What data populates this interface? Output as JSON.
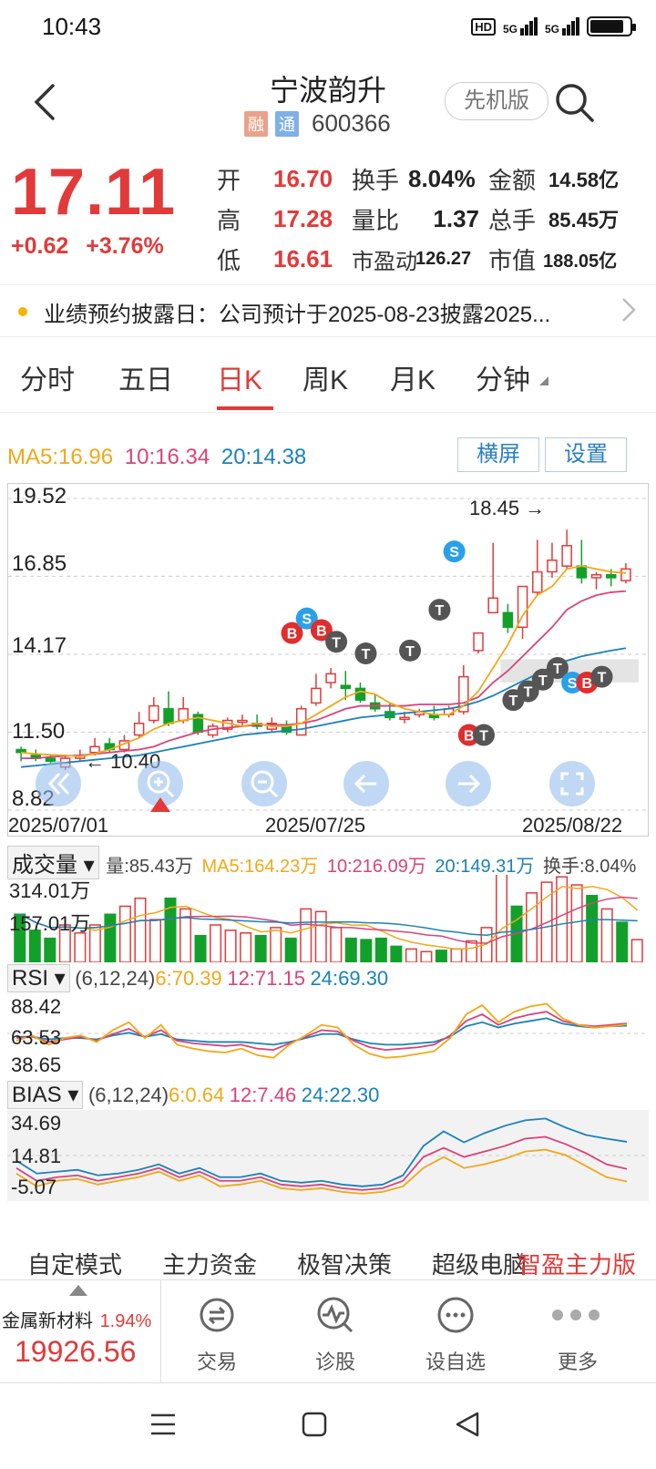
{
  "status": {
    "time": "10:43",
    "hd": "HD",
    "net1": "5G",
    "net2": "5G"
  },
  "header": {
    "title": "宁波韵升",
    "tag_rong": "融",
    "tag_tong": "通",
    "code": "600366",
    "pilot_button": "先机版"
  },
  "quote": {
    "price": "17.11",
    "change": "+0.62",
    "change_pct": "+3.76%",
    "stats": [
      {
        "l1": "开",
        "v1": "16.70",
        "l2": "换手",
        "v2": "8.04%",
        "l3": "金额",
        "v3": "14.58亿"
      },
      {
        "l1": "高",
        "v1": "17.28",
        "l2": "量比",
        "v2": "1.37",
        "l3": "总手",
        "v3": "85.45万"
      },
      {
        "l1": "低",
        "v1": "16.61",
        "l2": "市盈动",
        "v2": "126.27",
        "l3": "市值",
        "v3": "188.05亿"
      }
    ]
  },
  "notice": {
    "text": "业绩预约披露日：公司预计于2025-08-23披露2025..."
  },
  "tabs": [
    "分时",
    "五日",
    "日K",
    "周K",
    "月K",
    "分钟"
  ],
  "active_tab": "日K",
  "ma": {
    "ma5": "MA5:16.96",
    "ma10": "10:16.34",
    "ma20": "20:14.38"
  },
  "chart_buttons": {
    "landscape": "横屏",
    "settings": "设置"
  },
  "colors": {
    "up": "#e23a3a",
    "down": "#12a02a",
    "ma5": "#f0a818",
    "ma10": "#d8437a",
    "ma20": "#1a82b8",
    "accent": "#2a7fc0"
  },
  "chart_data": {
    "type": "candlestick",
    "y_ticks": [
      "19.52",
      "16.85",
      "14.17",
      "11.50",
      "8.82"
    ],
    "ylim": [
      8.82,
      19.52
    ],
    "dates": [
      "2025/07/01",
      "2025/07/25",
      "2025/08/22"
    ],
    "annotations": {
      "high": "18.45",
      "low": "10.40"
    },
    "candles": [
      [
        10.9,
        10.8,
        11.0,
        10.5
      ],
      [
        10.7,
        10.6,
        10.9,
        10.5
      ],
      [
        10.6,
        10.5,
        10.7,
        10.4
      ],
      [
        10.3,
        10.6,
        10.7,
        10.2
      ],
      [
        10.6,
        10.7,
        10.9,
        10.5
      ],
      [
        10.8,
        11.0,
        11.3,
        10.7
      ],
      [
        11.1,
        10.9,
        11.3,
        10.8
      ],
      [
        10.9,
        11.2,
        11.4,
        10.8
      ],
      [
        11.4,
        11.8,
        12.2,
        11.3
      ],
      [
        11.9,
        12.4,
        12.7,
        11.8
      ],
      [
        12.3,
        11.8,
        12.9,
        11.7
      ],
      [
        11.9,
        12.3,
        12.7,
        11.8
      ],
      [
        12.1,
        11.5,
        12.2,
        11.4
      ],
      [
        11.4,
        11.7,
        11.8,
        11.3
      ],
      [
        11.6,
        11.9,
        12.0,
        11.5
      ],
      [
        11.9,
        11.9,
        12.1,
        11.7
      ],
      [
        11.8,
        11.7,
        12.1,
        11.6
      ],
      [
        11.6,
        11.8,
        12.0,
        11.5
      ],
      [
        11.7,
        11.5,
        11.9,
        11.4
      ],
      [
        11.4,
        12.3,
        12.4,
        11.4
      ],
      [
        12.5,
        13.0,
        13.5,
        12.4
      ],
      [
        13.2,
        13.5,
        13.7,
        13.0
      ],
      [
        13.1,
        13.0,
        13.6,
        12.6
      ],
      [
        13.0,
        12.6,
        13.2,
        12.5
      ],
      [
        12.5,
        12.3,
        12.8,
        12.2
      ],
      [
        12.2,
        12.0,
        12.5,
        11.9
      ],
      [
        12.0,
        12.0,
        12.2,
        11.8
      ],
      [
        12.1,
        12.2,
        12.3,
        12.0
      ],
      [
        12.1,
        12.0,
        12.4,
        11.9
      ],
      [
        12.1,
        12.3,
        12.4,
        12.0
      ],
      [
        12.2,
        13.4,
        13.8,
        12.1
      ],
      [
        14.3,
        14.9,
        14.9,
        14.2
      ],
      [
        15.6,
        16.1,
        18.0,
        15.6
      ],
      [
        15.6,
        15.1,
        15.9,
        14.9
      ],
      [
        15.1,
        16.5,
        16.5,
        14.7
      ],
      [
        16.3,
        17.0,
        18.1,
        16.2
      ],
      [
        17.0,
        17.4,
        18.0,
        16.8
      ],
      [
        17.2,
        17.9,
        18.45,
        17.1
      ],
      [
        17.2,
        16.8,
        18.1,
        16.6
      ],
      [
        16.8,
        16.9,
        17.0,
        16.4
      ],
      [
        16.9,
        16.8,
        17.1,
        16.5
      ],
      [
        16.7,
        17.1,
        17.3,
        16.6
      ]
    ],
    "ma5": [
      10.8,
      10.75,
      10.72,
      10.7,
      10.66,
      10.76,
      10.9,
      11.1,
      11.3,
      11.6,
      11.8,
      11.9,
      12.0,
      11.9,
      11.8,
      11.7,
      11.8,
      11.7,
      11.7,
      11.8,
      12.1,
      12.4,
      12.7,
      12.9,
      12.8,
      12.5,
      12.3,
      12.2,
      12.1,
      12.1,
      12.4,
      12.9,
      13.7,
      14.5,
      15.5,
      16.2,
      16.5,
      17.1,
      17.2,
      17.1,
      17.0,
      16.96
    ],
    "ma10": [
      10.6,
      10.6,
      10.65,
      10.68,
      10.7,
      10.75,
      10.8,
      10.85,
      10.9,
      11.0,
      11.2,
      11.35,
      11.5,
      11.6,
      11.65,
      11.7,
      11.75,
      11.75,
      11.75,
      11.8,
      11.9,
      12.1,
      12.3,
      12.4,
      12.4,
      12.4,
      12.4,
      12.45,
      12.45,
      12.45,
      12.5,
      12.7,
      13.2,
      13.6,
      14.1,
      14.6,
      15.1,
      15.7,
      16.0,
      16.2,
      16.3,
      16.34
    ],
    "ma20": [
      10.3,
      10.35,
      10.4,
      10.45,
      10.5,
      10.55,
      10.6,
      10.65,
      10.7,
      10.8,
      10.9,
      11.0,
      11.1,
      11.2,
      11.3,
      11.4,
      11.45,
      11.5,
      11.55,
      11.6,
      11.7,
      11.8,
      11.9,
      12.0,
      12.05,
      12.1,
      12.15,
      12.2,
      12.25,
      12.3,
      12.4,
      12.55,
      12.75,
      13.0,
      13.25,
      13.5,
      13.75,
      13.95,
      14.1,
      14.2,
      14.3,
      14.38
    ]
  },
  "volume": {
    "title": "成交量",
    "info": "量:85.43万",
    "ma5": "MA5:164.23万",
    "ma10": "10:216.09万",
    "ma20": "20:149.31万",
    "turnover": "换手:8.04%",
    "ticks": [
      "314.01万",
      "157.01万"
    ],
    "max": 314.01,
    "values": [
      180,
      120,
      90,
      140,
      110,
      140,
      180,
      210,
      240,
      160,
      240,
      200,
      100,
      140,
      120,
      110,
      100,
      130,
      90,
      200,
      190,
      130,
      90,
      85,
      90,
      60,
      50,
      40,
      45,
      50,
      80,
      130,
      330,
      210,
      260,
      300,
      320,
      290,
      250,
      200,
      150,
      85
    ]
  },
  "rsi": {
    "title": "RSI",
    "params": "(6,12,24)",
    "r6": "6:70.39",
    "r12": "12:71.15",
    "r24": "24:69.30",
    "ticks": [
      "88.42",
      "63.53",
      "38.65"
    ],
    "ylim": [
      38.65,
      88.42
    ],
    "rsi6": [
      58,
      62,
      55,
      60,
      62,
      57,
      66,
      72,
      60,
      70,
      55,
      52,
      50,
      49,
      52,
      47,
      45,
      55,
      62,
      70,
      68,
      55,
      48,
      45,
      46,
      48,
      50,
      60,
      78,
      85,
      72,
      80,
      84,
      86,
      75,
      70,
      68,
      69,
      70.39
    ],
    "rsi12": [
      60,
      61,
      57,
      59,
      61,
      58,
      63,
      67,
      61,
      66,
      58,
      56,
      55,
      54,
      55,
      52,
      51,
      56,
      61,
      66,
      65,
      58,
      53,
      51,
      52,
      53,
      55,
      62,
      73,
      78,
      70,
      75,
      78,
      80,
      73,
      70,
      69,
      70,
      71.15
    ],
    "rsi24": [
      61,
      61,
      59,
      60,
      60,
      59,
      62,
      64,
      61,
      63,
      59,
      58,
      57,
      57,
      57,
      56,
      55,
      57,
      60,
      63,
      63,
      59,
      56,
      55,
      55,
      56,
      57,
      61,
      69,
      72,
      68,
      71,
      73,
      75,
      71,
      69,
      68,
      69,
      69.3
    ]
  },
  "bias": {
    "title": "BIAS",
    "params": "(6,12,24)",
    "b6": "6:0.64",
    "b12": "12:7.46",
    "b24": "24:22.30",
    "ticks": [
      "34.69",
      "14.81",
      "-5.07"
    ],
    "ylim": [
      -5.07,
      34.69
    ],
    "bias6": [
      5,
      -2,
      1,
      2,
      -1,
      1,
      3,
      6,
      1,
      4,
      -2,
      -1,
      1,
      -3,
      -4,
      -3,
      -5,
      -6,
      -5,
      -2,
      8,
      14,
      8,
      10,
      13,
      17,
      18,
      15,
      9,
      3,
      0.64
    ],
    "bias12": [
      8,
      1,
      3,
      4,
      1,
      3,
      5,
      8,
      3,
      6,
      1,
      1,
      3,
      -1,
      -2,
      -1,
      -3,
      -4,
      -3,
      1,
      14,
      19,
      14,
      17,
      20,
      24,
      25,
      21,
      16,
      10,
      7.46
    ],
    "bias24": [
      12,
      5,
      6,
      7,
      4,
      5,
      7,
      10,
      5,
      8,
      3,
      3,
      5,
      1,
      0,
      1,
      -1,
      -2,
      -1,
      4,
      20,
      28,
      22,
      27,
      31,
      34,
      35,
      30,
      26,
      24,
      22.3
    ]
  },
  "modes": [
    "自定模式",
    "主力资金",
    "极智决策",
    "超级电脑",
    "智盈主力版"
  ],
  "bottom": {
    "index_name": "金属新材料",
    "index_pct": "1.94%",
    "index_value": "19926.56",
    "nav": [
      "交易",
      "诊股",
      "设自选",
      "更多"
    ]
  }
}
